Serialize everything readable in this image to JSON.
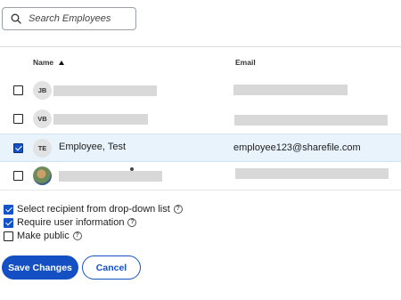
{
  "search": {
    "placeholder": "Search Employees",
    "icon": "search-icon"
  },
  "table": {
    "columns": {
      "name": "Name",
      "email": "Email"
    },
    "rows": [
      {
        "initials": "JB",
        "name": "",
        "email": "",
        "checked": false
      },
      {
        "initials": "VB",
        "name": "",
        "email": "",
        "checked": false
      },
      {
        "initials": "TE",
        "name": "Employee, Test",
        "email": "employee123@sharefile.com",
        "checked": true
      },
      {
        "initials": "",
        "name": "",
        "email": "",
        "checked": false
      }
    ]
  },
  "options": [
    {
      "label": "Select recipient from drop-down list",
      "checked": true
    },
    {
      "label": "Require user information",
      "checked": true
    },
    {
      "label": "Make public",
      "checked": false
    }
  ],
  "buttons": {
    "save": "Save Changes",
    "cancel": "Cancel"
  },
  "colors": {
    "primary": "#1450c4",
    "selected_row": "#e8f3fb"
  }
}
